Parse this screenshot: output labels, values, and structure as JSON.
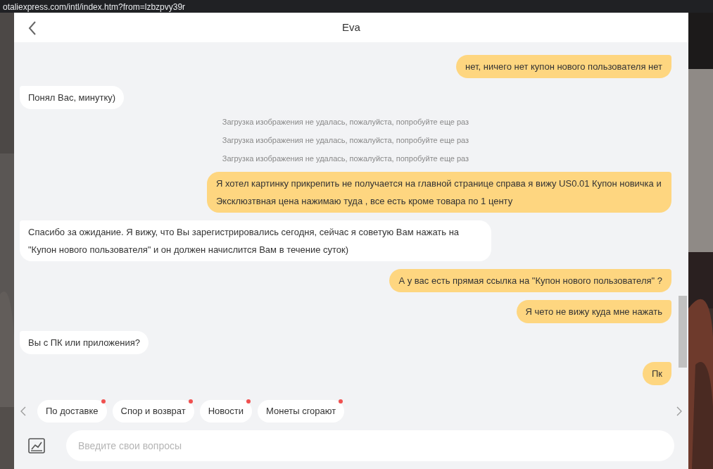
{
  "browser": {
    "url": "otaliexpress.com/intl/index.htm?from=lzbzpvy39r"
  },
  "header": {
    "title": "Eva"
  },
  "messages": [
    {
      "kind": "user",
      "text": "нет, ничего нет купон нового пользователя нет"
    },
    {
      "kind": "agent",
      "text": "Понял Вас, минутку)"
    },
    {
      "kind": "system",
      "text": "Загрузка изображения не удалась, пожалуйста, попробуйте еще раз"
    },
    {
      "kind": "system",
      "text": "Загрузка изображения не удалась, пожалуйста, попробуйте еще раз"
    },
    {
      "kind": "system",
      "text": "Загрузка изображения не удалась, пожалуйста, попробуйте еще раз"
    },
    {
      "kind": "user",
      "text": "Я хотел картинку прикрепить не получается на главной странице  справа я вижу  US0.01 Купон новичка  и  Эксклюзтвная цена нажимаю туда , все есть кроме товара по 1 центу"
    },
    {
      "kind": "agent",
      "text": "Спасибо за ожидание. Я вижу, что Вы зарегистрировались сегодня, сейчас я советую Вам нажать на \"Купон нового пользователя\" и он должен начислится Вам в течение суток)"
    },
    {
      "kind": "user",
      "text": "А у вас есть прямая ссылка на \"Купон нового пользователя\" ?"
    },
    {
      "kind": "user",
      "text": "Я чето не вижу куда мне нажать"
    },
    {
      "kind": "agent",
      "text": "Вы с ПК или приложения?"
    },
    {
      "kind": "user",
      "text": "Пк"
    }
  ],
  "quick_replies": [
    {
      "label": "По доставке",
      "badge": true
    },
    {
      "label": "Спор и возврат",
      "badge": true
    },
    {
      "label": "Новости",
      "badge": true
    },
    {
      "label": "Монеты сгорают",
      "badge": true
    }
  ],
  "input": {
    "placeholder": "Введите свои вопросы"
  }
}
